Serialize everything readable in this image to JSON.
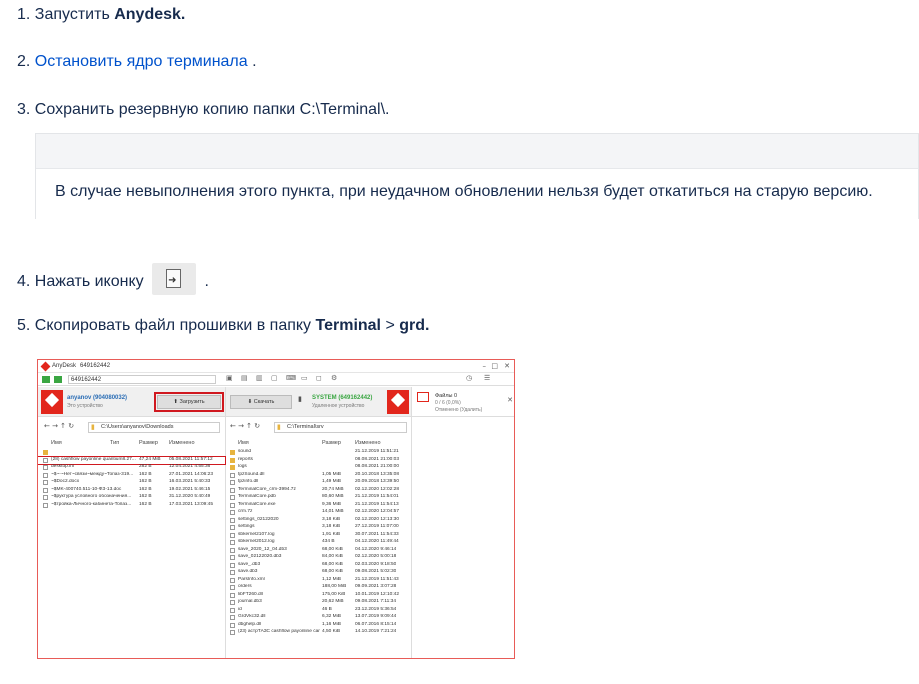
{
  "steps": [
    {
      "num": "1.",
      "text": "Запустить ",
      "bold": "Anydesk."
    },
    {
      "num": "2.",
      "link": "Остановить ядро терминала",
      "after": " ."
    },
    {
      "num": "3.",
      "text": "Сохранить резервную копию папки C:\\Terminal\\."
    },
    {
      "num": "4.",
      "text": "Нажать иконку",
      "after": "."
    },
    {
      "num": "5.",
      "text": "Скопировать файл прошивки в папку ",
      "bold": "Terminal",
      "sep": " > ",
      "bold2": "grd."
    }
  ],
  "note": "В случае невыполнения этого пункта, при неудачном обновлении нельзя будет откатиться на старую версию.",
  "icon_step4": "file-arrow-icon",
  "screenshot": {
    "app_name": "AnyDesk",
    "tab_title": "649162442",
    "address": "649162442",
    "left": {
      "user": "anyanov (904080032)",
      "user_sub": "Это устройство",
      "upload_btn": "Загрузить",
      "path": "C:\\Users\\anyanov\\Downloads",
      "cols": [
        "Имя",
        "Тип",
        "Размер",
        "Изменено"
      ],
      "rows": [
        {
          "name": "",
          "type": "",
          "size": "",
          "date": "",
          "kind": "folder"
        },
        {
          "name": "(28) cashflow payonline quantium8.27...",
          "type": "",
          "size": "47,24 MiB",
          "date": "05.08.2021 11:57:12",
          "kind": "file"
        },
        {
          "name": "desktop.ini",
          "type": "",
          "size": "282 B",
          "date": "12.04.2021 4:55:36",
          "kind": "file"
        },
        {
          "name": "~$~-~Нет~связи~между~Топаз-319...",
          "type": "",
          "size": "162 B",
          "date": "27.01.2021 14:06:23",
          "kind": "file"
        },
        {
          "name": "~$Doc2.docx",
          "type": "",
          "size": "162 B",
          "date": "16.03.2021 5:40:33",
          "kind": "file"
        },
        {
          "name": "~$MK-400740.511-10-ФЗ-13.doc",
          "type": "",
          "size": "162 B",
          "date": "19.02.2021 5:46:15",
          "kind": "file"
        },
        {
          "name": "~$руктура условного обозначения...",
          "type": "",
          "size": "162 B",
          "date": "31.12.2020 5:40:49",
          "kind": "file"
        },
        {
          "name": "~$тройка-Личного-кабинета-Топаз...",
          "type": "",
          "size": "162 B",
          "date": "17.03.2021 13:09:45",
          "kind": "file"
        }
      ]
    },
    "right": {
      "download_btn": "Скачать",
      "user": "SYSTEM (649162442)",
      "user_sub": "Удаленное устройство",
      "path": "C:\\Terminal\\srv",
      "cols": [
        "Имя",
        "Размер",
        "Изменено"
      ],
      "rows": [
        {
          "name": "sound",
          "size": "",
          "date": "21.12.2019 11:51:21",
          "kind": "folder"
        },
        {
          "name": "reports",
          "size": "",
          "date": "08.08.2021 21:00:03",
          "kind": "folder"
        },
        {
          "name": "logs",
          "size": "",
          "date": "08.08.2021 21:00:00",
          "kind": "folder"
        },
        {
          "name": "tpzSound.dll",
          "size": "1,05 MiB",
          "date": "20.10.2018 13:35:08",
          "kind": "file"
        },
        {
          "name": "tpzinfo.dll",
          "size": "1,49 MiB",
          "date": "20.09.2018 13:39:50",
          "kind": "file"
        },
        {
          "name": "TerminalCore_crm-3994.7z",
          "size": "20,74 MiB",
          "date": "02.12.2020 12:02:28",
          "kind": "file"
        },
        {
          "name": "TerminalCore.pdb",
          "size": "80,60 MiB",
          "date": "21.12.2019 11:54:01",
          "kind": "file"
        },
        {
          "name": "TerminalCore.exe",
          "size": "9,36 MiB",
          "date": "21.12.2019 11:54:13",
          "kind": "file"
        },
        {
          "name": "crm.7z",
          "size": "14,01 MiB",
          "date": "02.12.2020 12:04:57",
          "kind": "file"
        },
        {
          "name": "settings_02122020",
          "size": "3,18 KiB",
          "date": "02.12.2020 12:13:30",
          "kind": "file"
        },
        {
          "name": "settings",
          "size": "3,18 KiB",
          "date": "27.12.2019 11:07:00",
          "kind": "file"
        },
        {
          "name": "sbkernel2107.log",
          "size": "1,91 KiB",
          "date": "30.07.2021 11:54:33",
          "kind": "file"
        },
        {
          "name": "sbkernel2012.log",
          "size": "434 B",
          "date": "04.12.2020 11:49:44",
          "kind": "file"
        },
        {
          "name": "save_2020_12_04.db3",
          "size": "68,00 KiB",
          "date": "04.12.2020 9:46:14",
          "kind": "file"
        },
        {
          "name": "save_02122020.db3",
          "size": "84,00 KiB",
          "date": "02.12.2020 5:00:18",
          "kind": "file"
        },
        {
          "name": "save_.db3",
          "size": "68,00 KiB",
          "date": "02.03.2020 9:18:50",
          "kind": "file"
        },
        {
          "name": "save.db3",
          "size": "68,00 KiB",
          "date": "09.08.2021 5:02:30",
          "kind": "file"
        },
        {
          "name": "ParsInfo.xml",
          "size": "1,12 MiB",
          "date": "21.12.2019 11:51:43",
          "kind": "file"
        },
        {
          "name": "orders",
          "size": "188,00 MiB",
          "date": "09.09.2021 3:07:28",
          "kind": "file"
        },
        {
          "name": "libFT260.dll",
          "size": "175,00 KiB",
          "date": "10.01.2019 12:10:42",
          "kind": "file"
        },
        {
          "name": "journal.db3",
          "size": "20,62 MiB",
          "date": "09.08.2021 7:11:34",
          "kind": "file"
        },
        {
          "name": "id",
          "size": "46 B",
          "date": "23.12.2019 5:36:54",
          "kind": "file"
        },
        {
          "name": "GrdVkc32.dll",
          "size": "6,32 MiB",
          "date": "13.07.2019 9:09:44",
          "kind": "file"
        },
        {
          "name": "dbghelp.dll",
          "size": "1,16 MiB",
          "date": "06.07.2016 8:15:14",
          "kind": "file"
        },
        {
          "name": "(23) астрТАЗС cashflow payonline car...",
          "size": "4,50 KiB",
          "date": "14.10.2019 7:21:24",
          "kind": "file"
        }
      ]
    },
    "side": {
      "title": "Файлы 0",
      "status": "0 / 6 (0,0%)",
      "sub": "Отменено (Удалить)"
    }
  }
}
